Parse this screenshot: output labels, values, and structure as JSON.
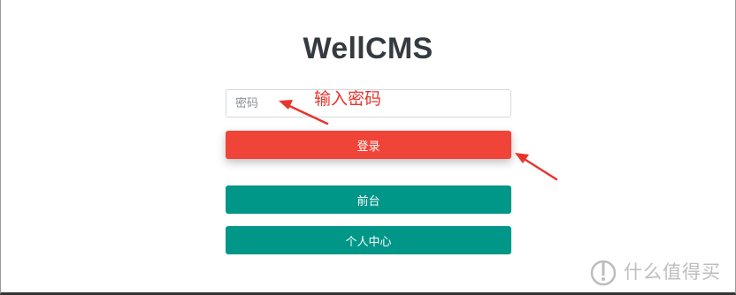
{
  "app": {
    "title": "WellCMS"
  },
  "form": {
    "password_placeholder": "密码",
    "login_label": "登录",
    "frontend_label": "前台",
    "user_center_label": "个人中心"
  },
  "annotations": {
    "input_hint": "输入密码",
    "color": "#e8342c"
  },
  "watermark": {
    "text": "什么值得买"
  },
  "colors": {
    "login_button": "#f04438",
    "nav_button": "#009688",
    "title": "#343a40"
  }
}
